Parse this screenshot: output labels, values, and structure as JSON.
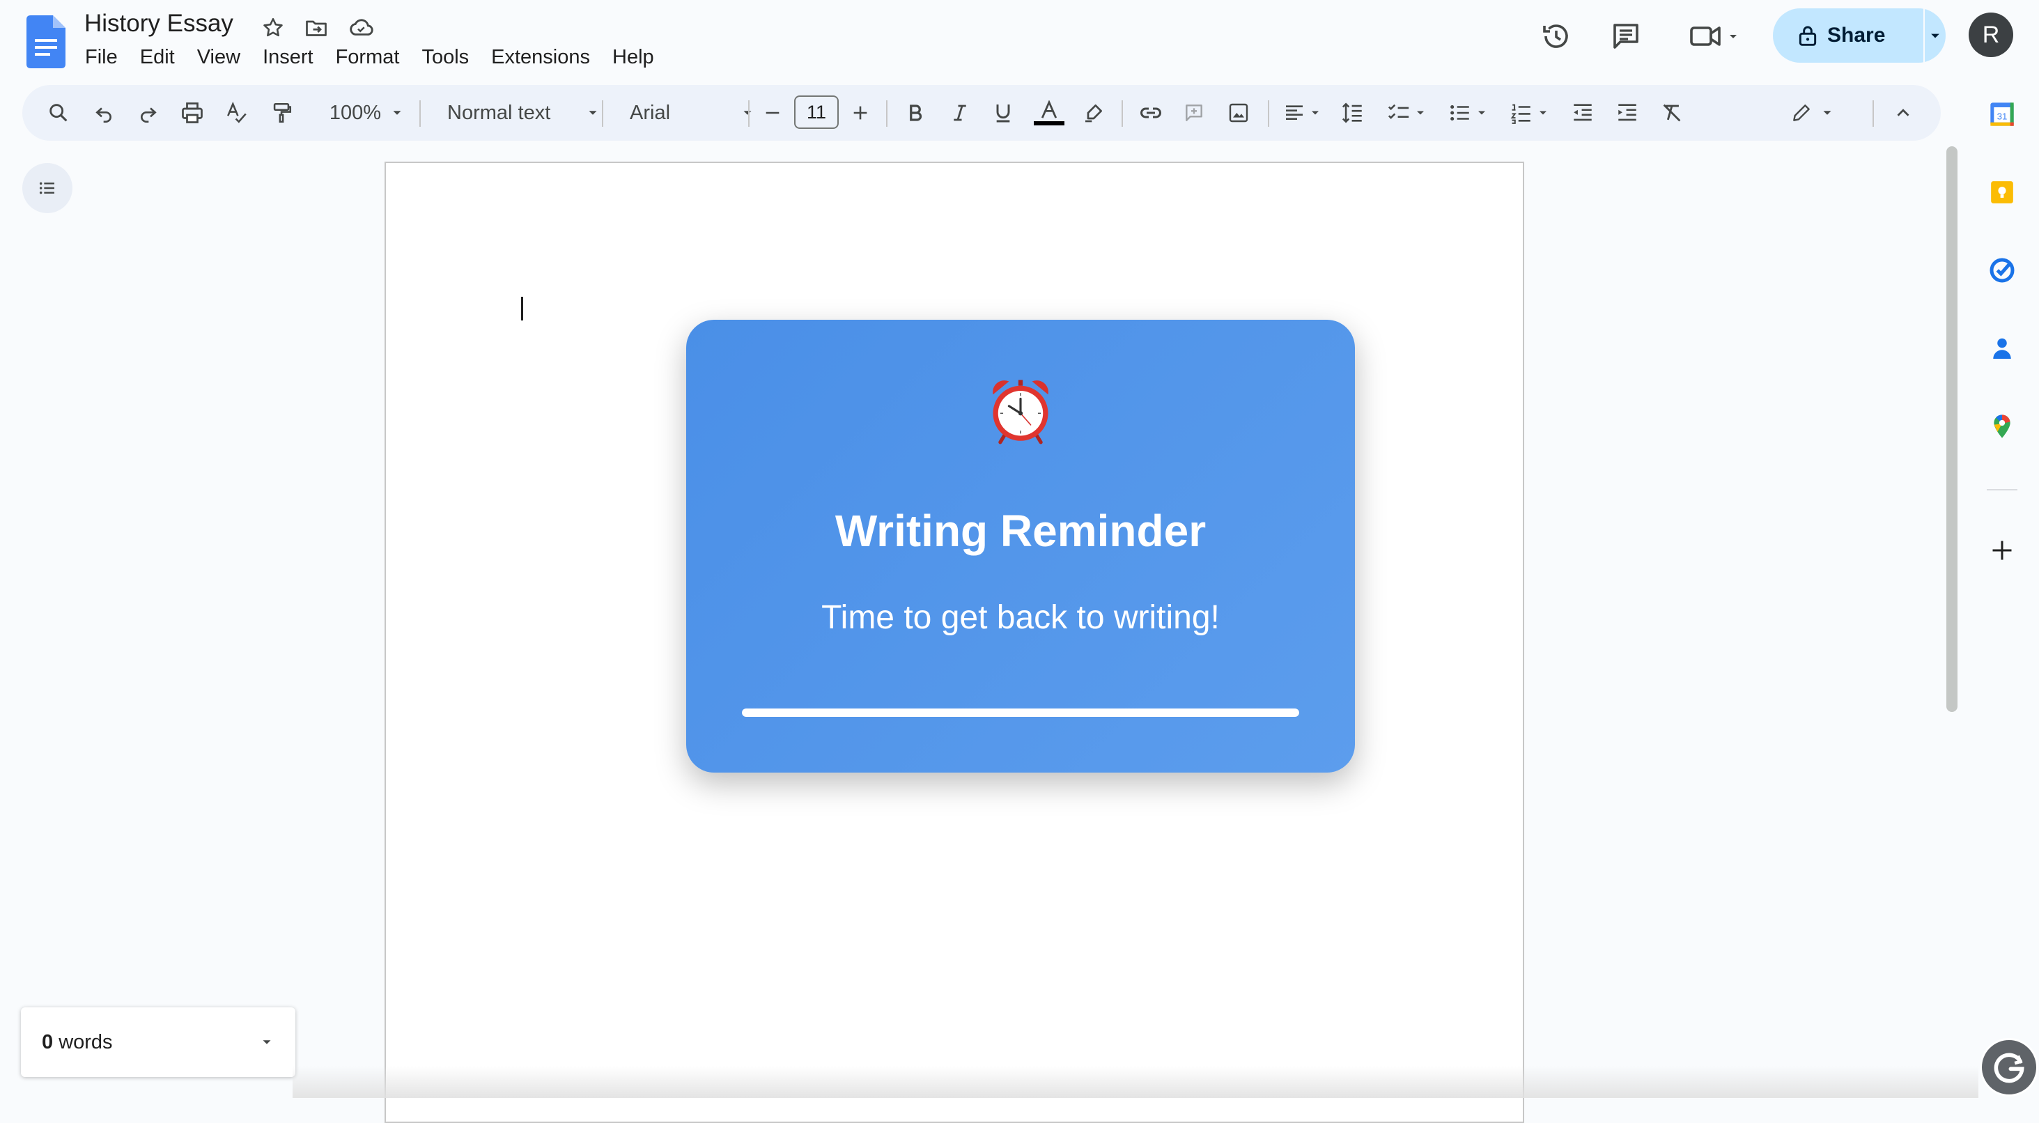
{
  "app": {
    "document_title": "History Essay",
    "brand_color": "#4285f4"
  },
  "menu": {
    "items": [
      "File",
      "Edit",
      "View",
      "Insert",
      "Format",
      "Tools",
      "Extensions",
      "Help"
    ]
  },
  "header": {
    "share_label": "Share",
    "share_bg_color": "#c2e7ff",
    "avatar_initial": "R"
  },
  "toolbar": {
    "zoom": "100%",
    "style": "Normal text",
    "font": "Arial",
    "font_size": "11",
    "text_color": "#000000"
  },
  "reminder": {
    "icon": "alarm-clock-icon",
    "title": "Writing Reminder",
    "message": "Time to get back to writing!",
    "progress": 1.0,
    "color": "#4a90e2"
  },
  "word_count": {
    "count": "0",
    "label": "words"
  },
  "side_panel": {
    "icons": [
      "calendar-icon",
      "keep-icon",
      "tasks-icon",
      "contacts-icon",
      "maps-icon",
      "add-icon"
    ],
    "calendar_label": "31"
  }
}
